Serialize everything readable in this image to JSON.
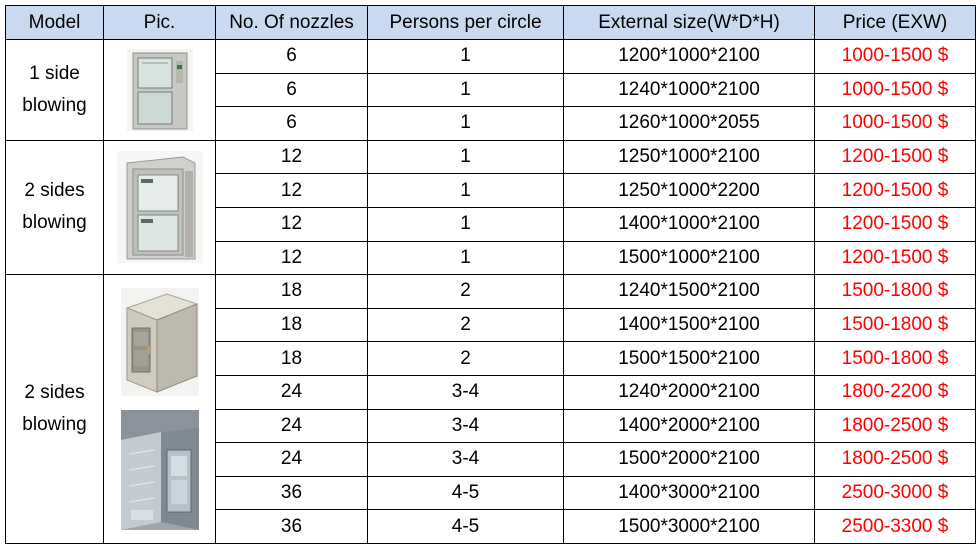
{
  "headers": [
    "Model",
    "Pic.",
    "No. Of nozzles",
    "Persons per circle",
    "External size(W*D*H)",
    "Price (EXW)"
  ],
  "groups": [
    {
      "model": "1 side blowing",
      "rows": [
        {
          "nozzles": "6",
          "persons": "1",
          "size": "1200*1000*2100",
          "price": "1000-1500 $"
        },
        {
          "nozzles": "6",
          "persons": "1",
          "size": "1240*1000*2100",
          "price": "1000-1500 $"
        },
        {
          "nozzles": "6",
          "persons": "1",
          "size": "1260*1000*2055",
          "price": "1000-1500 $"
        }
      ]
    },
    {
      "model": "2 sides blowing",
      "rows": [
        {
          "nozzles": "12",
          "persons": "1",
          "size": "1250*1000*2100",
          "price": "1200-1500 $"
        },
        {
          "nozzles": "12",
          "persons": "1",
          "size": "1250*1000*2200",
          "price": "1200-1500 $"
        },
        {
          "nozzles": "12",
          "persons": "1",
          "size": "1400*1000*2100",
          "price": "1200-1500 $"
        },
        {
          "nozzles": "12",
          "persons": "1",
          "size": "1500*1000*2100",
          "price": "1200-1500 $"
        }
      ]
    },
    {
      "model": "2 sides blowing",
      "rows": [
        {
          "nozzles": "18",
          "persons": "2",
          "size": "1240*1500*2100",
          "price": "1500-1800 $"
        },
        {
          "nozzles": "18",
          "persons": "2",
          "size": "1400*1500*2100",
          "price": "1500-1800 $"
        },
        {
          "nozzles": "18",
          "persons": "2",
          "size": "1500*1500*2100",
          "price": "1500-1800 $"
        },
        {
          "nozzles": "24",
          "persons": "3-4",
          "size": "1240*2000*2100",
          "price": "1800-2200 $"
        },
        {
          "nozzles": "24",
          "persons": "3-4",
          "size": "1400*2000*2100",
          "price": "1800-2500 $"
        },
        {
          "nozzles": "24",
          "persons": "3-4",
          "size": "1500*2000*2100",
          "price": "1800-2500 $"
        },
        {
          "nozzles": "36",
          "persons": "4-5",
          "size": "1400*3000*2100",
          "price": "2500-3000 $"
        },
        {
          "nozzles": "36",
          "persons": "4-5",
          "size": "1500*3000*2100",
          "price": "2500-3300 $"
        }
      ]
    }
  ],
  "colors": {
    "header_bg": "#c9daf0",
    "price": "#ff0000"
  },
  "icons": {
    "group_0": [
      "air-shower-1-side-photo"
    ],
    "group_1": [
      "air-shower-2-sides-photo"
    ],
    "group_2": [
      "air-shower-cabinet-photo",
      "air-shower-tunnel-photo"
    ]
  }
}
